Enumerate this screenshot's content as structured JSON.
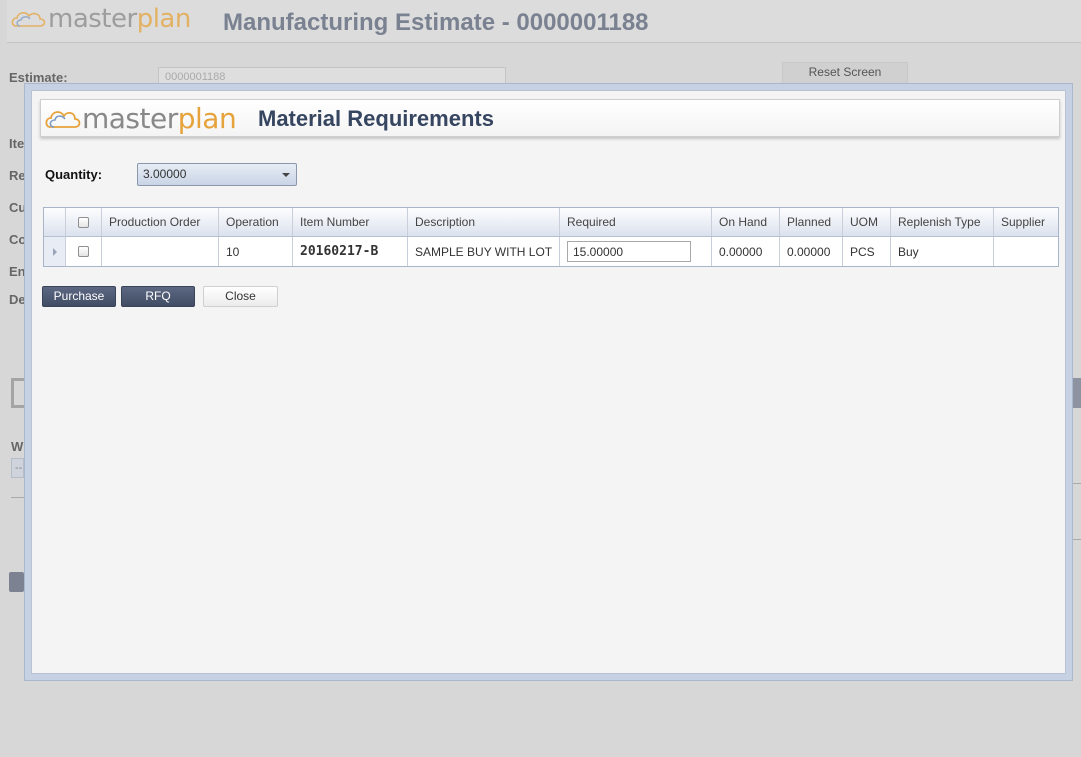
{
  "background": {
    "logo_text_main": "master",
    "logo_text_plan": "plan",
    "page_title": "Manufacturing Estimate - 0000001188",
    "estimate_label": "Estimate:",
    "estimate_value": "0000001188",
    "reset_label": "Reset Screen",
    "side_labels": [
      "Ite",
      "Re",
      "Cu",
      "Co",
      "En",
      "De"
    ],
    "w_label": "W",
    "dash_text": "--"
  },
  "modal": {
    "logo_text_main": "master",
    "logo_text_er": "er",
    "logo_text_plan": "plan",
    "title": "Material Requirements",
    "quantity_label": "Quantity:",
    "quantity_value": "3.00000",
    "grid": {
      "columns": [
        "Production Order",
        "Operation",
        "Item Number",
        "Description",
        "Required",
        "On Hand",
        "Planned",
        "UOM",
        "Replenish Type",
        "Supplier"
      ],
      "rows": [
        {
          "production_order": "",
          "operation": "10",
          "item_number": "20160217-B",
          "description": "SAMPLE BUY WITH LOT",
          "required": "15.00000",
          "on_hand": "0.00000",
          "planned": "0.00000",
          "uom": "PCS",
          "replenish_type": "Buy",
          "supplier": ""
        }
      ]
    },
    "buttons": {
      "purchase": "Purchase",
      "rfq": "RFQ",
      "close": "Close"
    }
  },
  "colors": {
    "brand_gray": "#888888",
    "brand_orange": "#e6a33c",
    "title_navy": "#364560",
    "button_dark": "#4a556e"
  }
}
